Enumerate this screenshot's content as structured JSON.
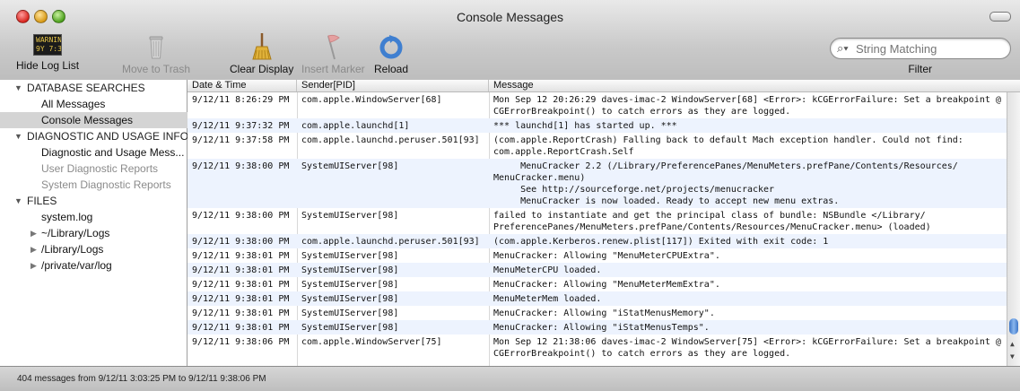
{
  "window": {
    "title": "Console Messages"
  },
  "toolbar": {
    "hide_log_list": "Hide Log List",
    "move_to_trash": "Move to Trash",
    "clear_display": "Clear Display",
    "insert_marker": "Insert Marker",
    "reload": "Reload",
    "filter_label": "Filter",
    "warn_icon_text": "WARNIN\n9Y 7:36",
    "search_placeholder": "String Matching"
  },
  "sidebar": {
    "sections": [
      {
        "label": "DATABASE SEARCHES"
      },
      {
        "label": "DIAGNOSTIC AND USAGE INFO..."
      },
      {
        "label": "FILES"
      }
    ],
    "items": [
      {
        "label": "All Messages"
      },
      {
        "label": "Console Messages"
      },
      {
        "label": "Diagnostic and Usage Mess..."
      },
      {
        "label": "User Diagnostic Reports"
      },
      {
        "label": "System Diagnostic Reports"
      },
      {
        "label": "system.log"
      },
      {
        "label": "~/Library/Logs"
      },
      {
        "label": "/Library/Logs"
      },
      {
        "label": "/private/var/log"
      }
    ]
  },
  "table": {
    "columns": [
      "Date & Time",
      "Sender[PID]",
      "Message"
    ],
    "rows": [
      {
        "date": "9/12/11 8:26:29 PM",
        "sender": "com.apple.WindowServer[68]",
        "message": "Mon Sep 12 20:26:29 daves-imac-2 WindowServer[68] <Error>: kCGErrorFailure: Set a breakpoint @\nCGErrorBreakpoint() to catch errors as they are logged."
      },
      {
        "date": "9/12/11 9:37:32 PM",
        "sender": "com.apple.launchd[1]",
        "message": "*** launchd[1] has started up. ***"
      },
      {
        "date": "9/12/11 9:37:58 PM",
        "sender": "com.apple.launchd.peruser.501[93]",
        "message": "(com.apple.ReportCrash) Falling back to default Mach exception handler. Could not find:\ncom.apple.ReportCrash.Self"
      },
      {
        "date": "9/12/11 9:38:00 PM",
        "sender": "SystemUIServer[98]",
        "message": "     MenuCracker 2.2 (/Library/PreferencePanes/MenuMeters.prefPane/Contents/Resources/\nMenuCracker.menu)\n     See http://sourceforge.net/projects/menucracker\n     MenuCracker is now loaded. Ready to accept new menu extras."
      },
      {
        "date": "9/12/11 9:38:00 PM",
        "sender": "SystemUIServer[98]",
        "message": "failed to instantiate and get the principal class of bundle: NSBundle </Library/\nPreferencePanes/MenuMeters.prefPane/Contents/Resources/MenuCracker.menu> (loaded)"
      },
      {
        "date": "9/12/11 9:38:00 PM",
        "sender": "com.apple.launchd.peruser.501[93]",
        "message": "(com.apple.Kerberos.renew.plist[117]) Exited with exit code: 1"
      },
      {
        "date": "9/12/11 9:38:01 PM",
        "sender": "SystemUIServer[98]",
        "message": "MenuCracker: Allowing \"MenuMeterCPUExtra\"."
      },
      {
        "date": "9/12/11 9:38:01 PM",
        "sender": "SystemUIServer[98]",
        "message": "MenuMeterCPU loaded."
      },
      {
        "date": "9/12/11 9:38:01 PM",
        "sender": "SystemUIServer[98]",
        "message": "MenuCracker: Allowing \"MenuMeterMemExtra\"."
      },
      {
        "date": "9/12/11 9:38:01 PM",
        "sender": "SystemUIServer[98]",
        "message": "MenuMeterMem loaded."
      },
      {
        "date": "9/12/11 9:38:01 PM",
        "sender": "SystemUIServer[98]",
        "message": "MenuCracker: Allowing \"iStatMenusMemory\"."
      },
      {
        "date": "9/12/11 9:38:01 PM",
        "sender": "SystemUIServer[98]",
        "message": "MenuCracker: Allowing \"iStatMenusTemps\"."
      },
      {
        "date": "9/12/11 9:38:06 PM",
        "sender": "com.apple.WindowServer[75]",
        "message": "Mon Sep 12 21:38:06 daves-imac-2 WindowServer[75] <Error>: kCGErrorFailure: Set a breakpoint @\nCGErrorBreakpoint() to catch errors as they are logged."
      }
    ]
  },
  "status": {
    "text": "404 messages from 9/12/11 3:03:25 PM to 9/12/11 9:38:06 PM"
  },
  "colors": {
    "selection": "#d4d4d4",
    "alt_row": "#edf3fe",
    "scroll_thumb": "#3d76c7"
  }
}
